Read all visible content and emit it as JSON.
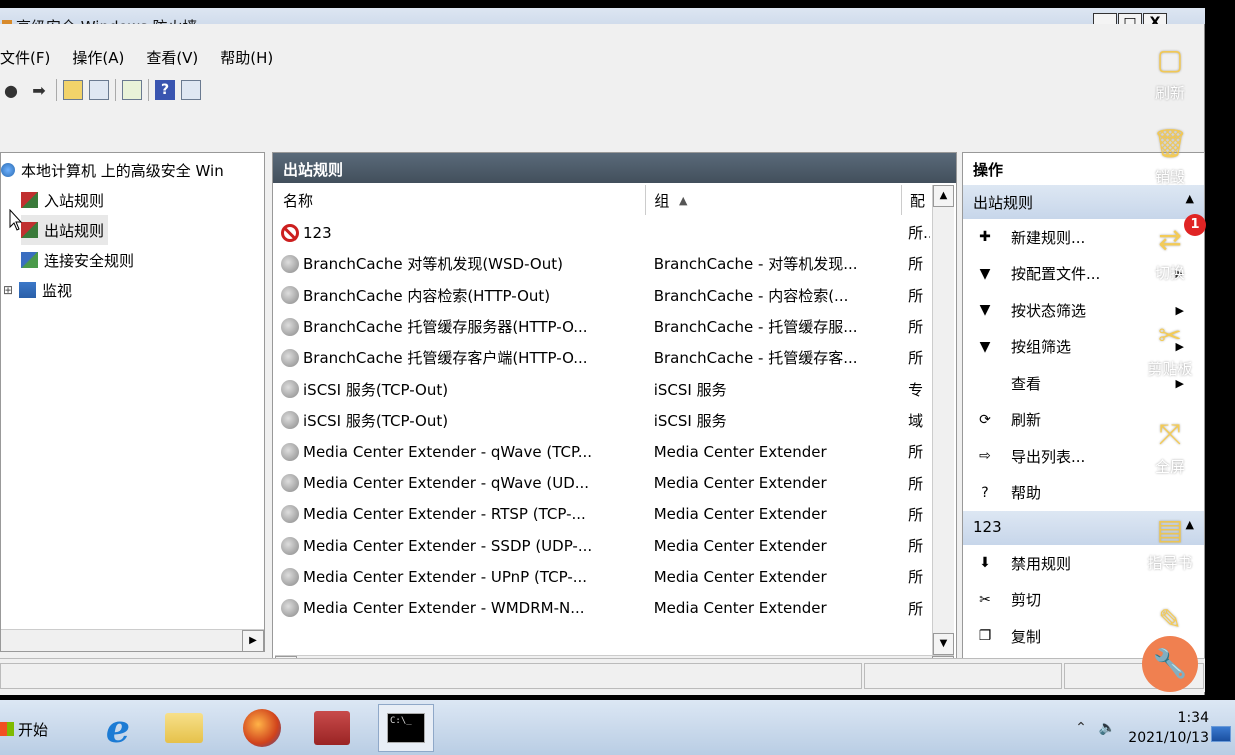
{
  "window": {
    "title": "高级安全 Windows 防火墙",
    "buttons": [
      "_",
      "□",
      "X"
    ]
  },
  "menu": [
    "文件(F)",
    "操作(A)",
    "查看(V)",
    "帮助(H)"
  ],
  "tree": {
    "root": "本地计算机 上的高级安全 Win",
    "items": [
      "入站规则",
      "出站规则",
      "连接安全规则",
      "监视"
    ],
    "expander": "⊞"
  },
  "list": {
    "title": "出站规则",
    "columns": [
      "名称",
      "组",
      "配"
    ],
    "sort_indicator": "▲",
    "rows": [
      {
        "icon": "block",
        "name": "123",
        "group": "",
        "profile": "所..."
      },
      {
        "icon": "gray",
        "name": "BranchCache 对等机发现(WSD-Out)",
        "group": "BranchCache - 对等机发现...",
        "profile": "所"
      },
      {
        "icon": "gray",
        "name": "BranchCache 内容检索(HTTP-Out)",
        "group": "BranchCache - 内容检索(...",
        "profile": "所"
      },
      {
        "icon": "gray",
        "name": "BranchCache 托管缓存服务器(HTTP-O...",
        "group": "BranchCache - 托管缓存服...",
        "profile": "所"
      },
      {
        "icon": "gray",
        "name": "BranchCache 托管缓存客户端(HTTP-O...",
        "group": "BranchCache - 托管缓存客...",
        "profile": "所"
      },
      {
        "icon": "gray",
        "name": "iSCSI 服务(TCP-Out)",
        "group": "iSCSI 服务",
        "profile": "专"
      },
      {
        "icon": "gray",
        "name": "iSCSI 服务(TCP-Out)",
        "group": "iSCSI 服务",
        "profile": "域"
      },
      {
        "icon": "gray",
        "name": "Media Center Extender - qWave (TCP...",
        "group": "Media Center Extender",
        "profile": "所"
      },
      {
        "icon": "gray",
        "name": "Media Center Extender - qWave (UD...",
        "group": "Media Center Extender",
        "profile": "所"
      },
      {
        "icon": "gray",
        "name": "Media Center Extender - RTSP (TCP-...",
        "group": "Media Center Extender",
        "profile": "所"
      },
      {
        "icon": "gray",
        "name": "Media Center Extender - SSDP (UDP-...",
        "group": "Media Center Extender",
        "profile": "所"
      },
      {
        "icon": "gray",
        "name": "Media Center Extender - UPnP (TCP-...",
        "group": "Media Center Extender",
        "profile": "所"
      },
      {
        "icon": "gray",
        "name": "Media Center Extender - WMDRM-N...",
        "group": "Media Center Extender",
        "profile": "所"
      }
    ]
  },
  "actions": {
    "header": "操作",
    "section1": "出站规则",
    "items1": [
      {
        "label": "新建规则...",
        "icon": "new-rule-icon",
        "glyph": "✚",
        "arrow": ""
      },
      {
        "label": "按配置文件...",
        "icon": "filter-icon",
        "glyph": "▼",
        "arrow": "▶"
      },
      {
        "label": "按状态筛选",
        "icon": "filter-icon",
        "glyph": "▼",
        "arrow": "▶"
      },
      {
        "label": "按组筛选",
        "icon": "filter-icon",
        "glyph": "▼",
        "arrow": "▶"
      },
      {
        "label": "查看",
        "icon": "view-icon",
        "glyph": "",
        "arrow": "▶"
      },
      {
        "label": "刷新",
        "icon": "refresh-icon",
        "glyph": "⟳",
        "arrow": ""
      },
      {
        "label": "导出列表...",
        "icon": "export-icon",
        "glyph": "⇨",
        "arrow": ""
      },
      {
        "label": "帮助",
        "icon": "help-icon",
        "glyph": "?",
        "arrow": ""
      }
    ],
    "section2": "123",
    "items2": [
      {
        "label": "禁用规则",
        "icon": "disable-icon",
        "glyph": "⬇"
      },
      {
        "label": "剪切",
        "icon": "cut-icon",
        "glyph": "✂"
      },
      {
        "label": "复制",
        "icon": "copy-icon",
        "glyph": "❐"
      }
    ]
  },
  "taskbar": {
    "start": "开始",
    "time": "1:34",
    "date": "2021/10/13"
  },
  "sidebar": {
    "items": [
      "刷新",
      "销毁",
      "切换",
      "剪贴板",
      "全屏",
      "指导书"
    ],
    "badge": "1"
  }
}
